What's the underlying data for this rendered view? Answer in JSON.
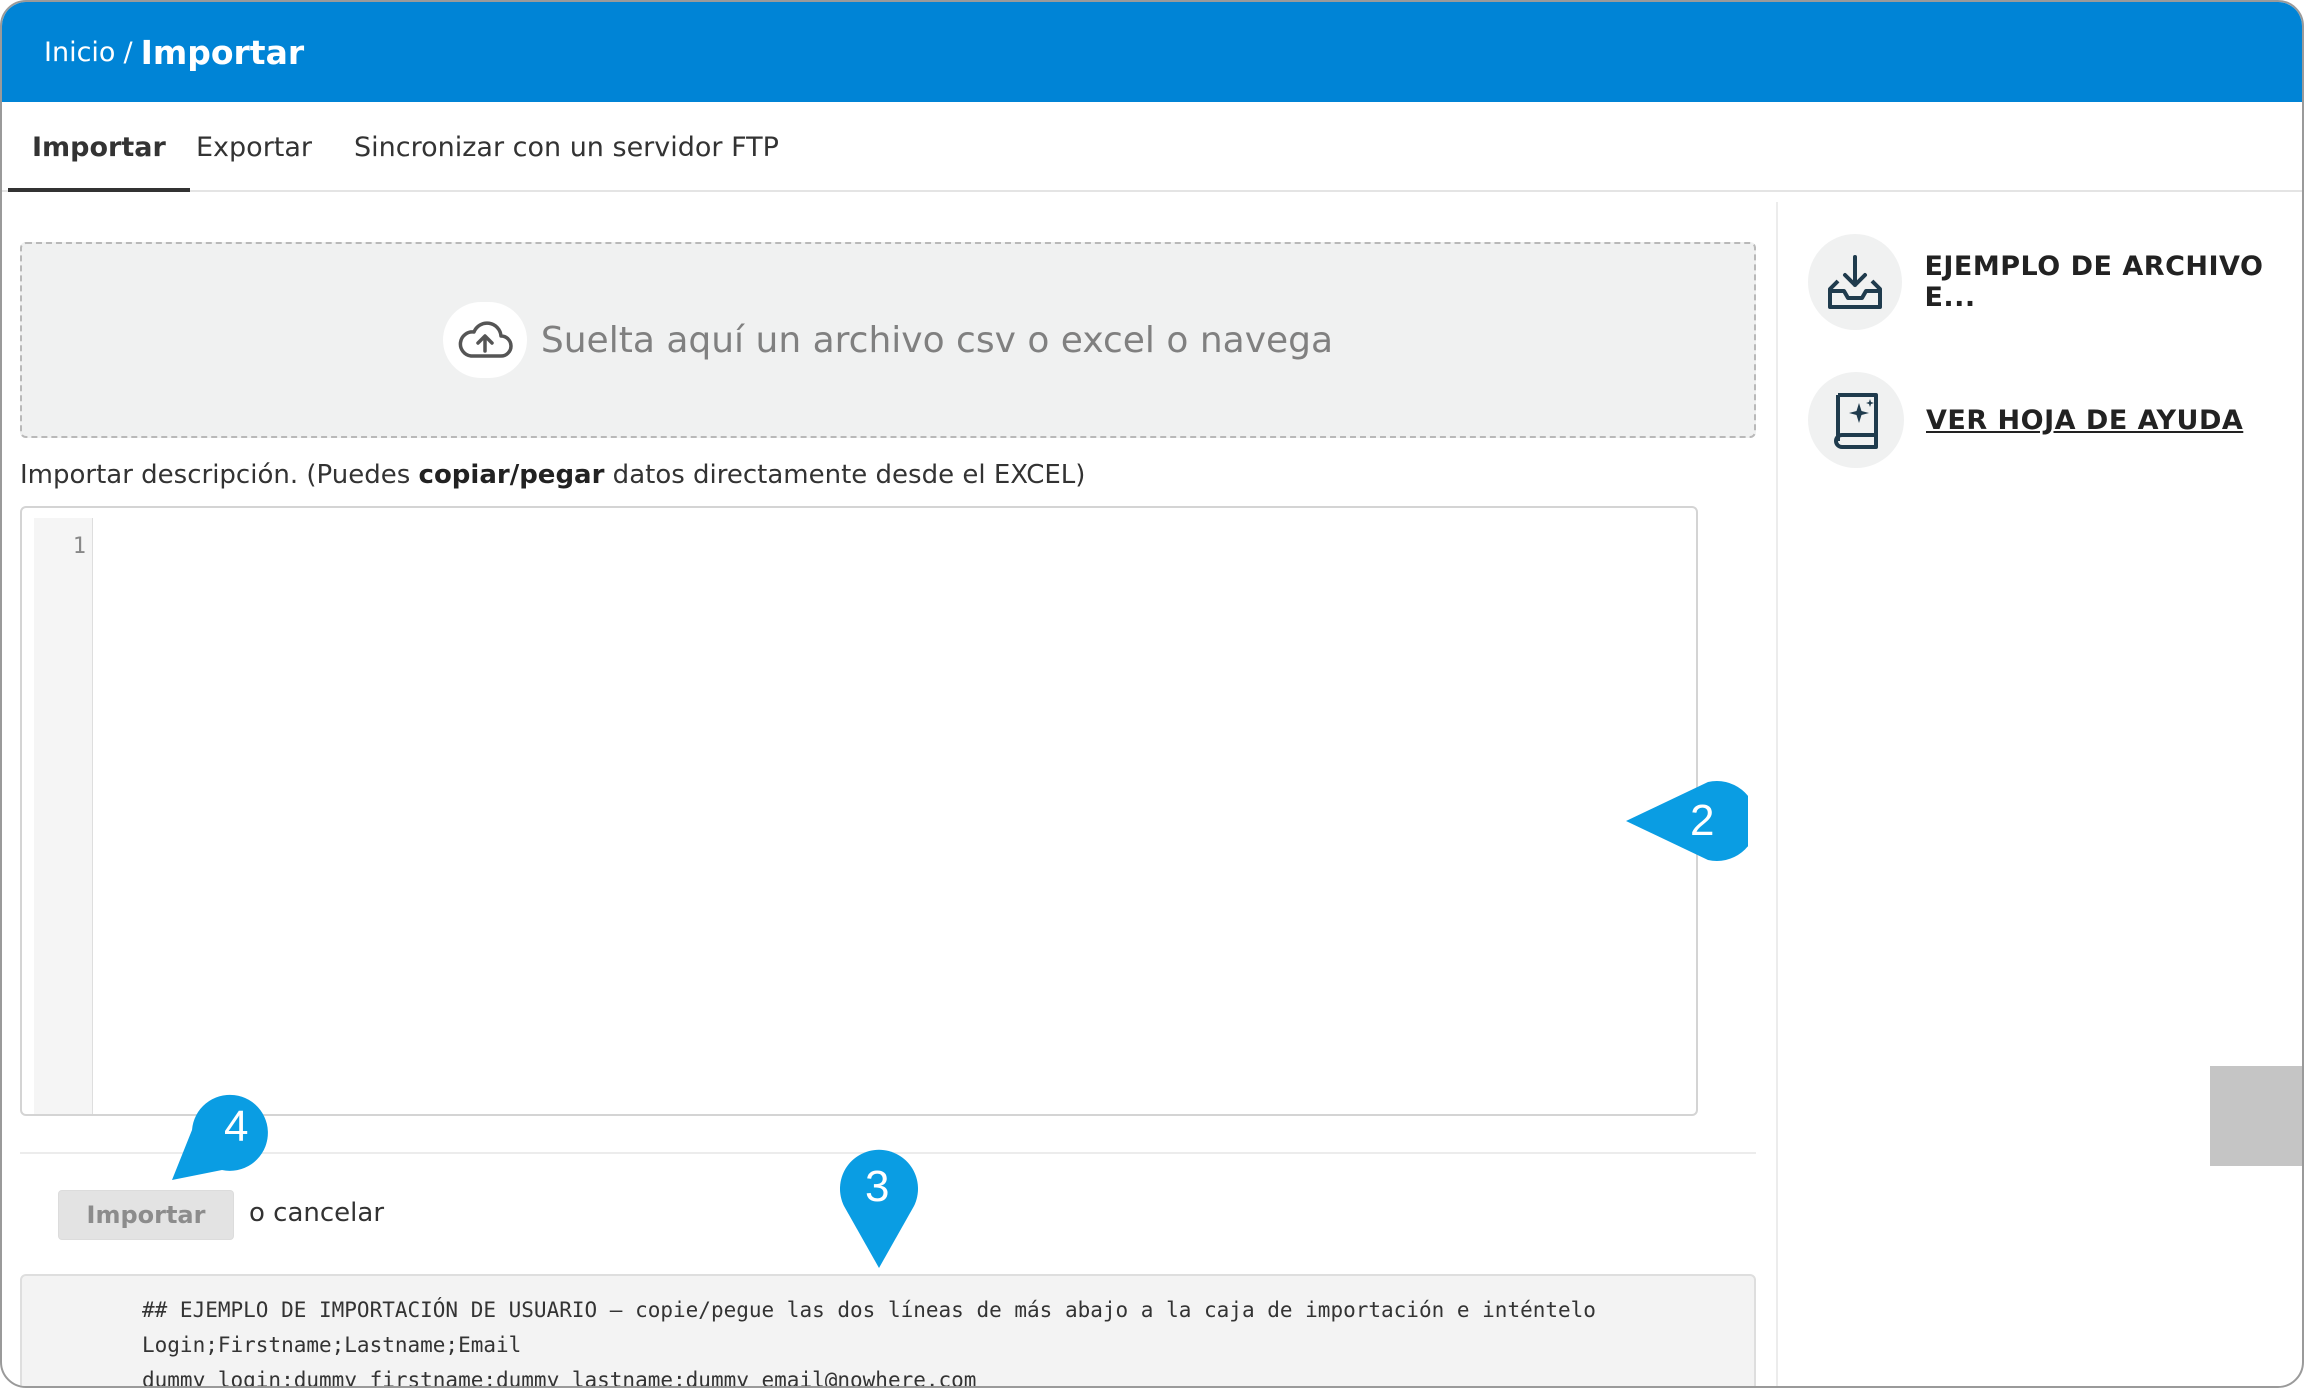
{
  "breadcrumb": {
    "home": "Inicio",
    "separator": "/",
    "current": "Importar"
  },
  "tabs": [
    {
      "label": "Importar",
      "active": true
    },
    {
      "label": "Exportar",
      "active": false
    },
    {
      "label": "Sincronizar con un servidor FTP",
      "active": false
    }
  ],
  "dropzone": {
    "icon": "cloud-upload-icon",
    "text": "Suelta aquí un archivo csv o excel o navega"
  },
  "description": {
    "prefix": "Importar descripción. (Puedes ",
    "bold": "copiar/pegar",
    "suffix": " datos directamente desde el EXCEL)"
  },
  "editor": {
    "line_number": "1",
    "content": ""
  },
  "actions": {
    "import_label": "Importar",
    "cancel_label": "o cancelar"
  },
  "example": {
    "lines": [
      "## EJEMPLO DE IMPORTACIÓN DE USUARIO – copie/pegue las dos líneas de más abajo a la caja de importación e inténtelo",
      "Login;Firstname;Lastname;Email",
      "dummy_login;dummy_firstname;dummy_lastname;dummy_email@nowhere.com"
    ]
  },
  "sidebar": {
    "items": [
      {
        "icon": "tray-download-icon",
        "label": "EJEMPLO DE ARCHIVO E..."
      },
      {
        "icon": "help-book-icon",
        "label": "VER HOJA DE AYUDA"
      }
    ]
  },
  "markers": [
    "2",
    "4",
    "3"
  ],
  "colors": {
    "header": "#0084d6",
    "marker": "#0a9de3"
  }
}
